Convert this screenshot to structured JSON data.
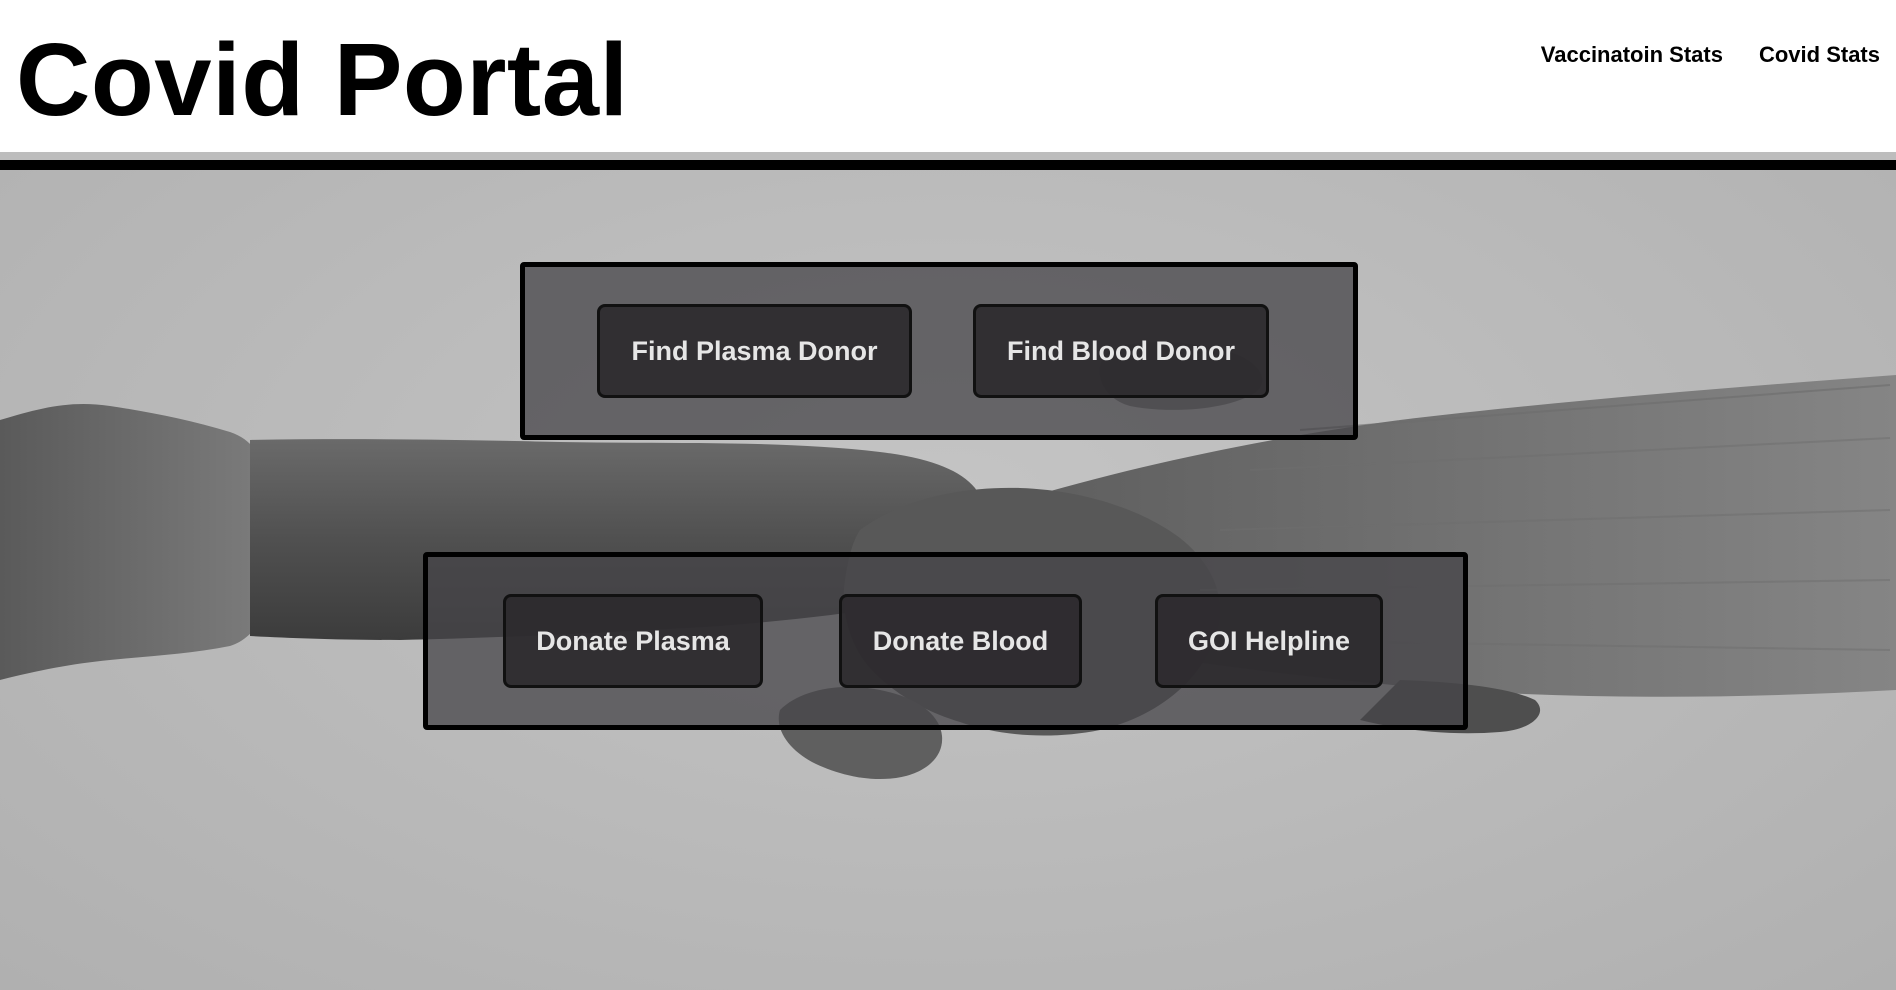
{
  "header": {
    "title": "Covid Portal",
    "nav": [
      {
        "label": "Vaccinatoin Stats"
      },
      {
        "label": "Covid Stats"
      }
    ]
  },
  "hero": {
    "find_panel": {
      "buttons": [
        {
          "label": "Find Plasma Donor"
        },
        {
          "label": "Find Blood Donor"
        }
      ]
    },
    "donate_panel": {
      "buttons": [
        {
          "label": "Donate Plasma"
        },
        {
          "label": "Donate Blood"
        },
        {
          "label": "GOI Helpline"
        }
      ]
    }
  },
  "colors": {
    "title": "#000000",
    "rule": "#000000",
    "panel_bg": "#464448",
    "button_bg": "#2d2a2e",
    "button_text": "#e6e6e6",
    "hero_bg": "#bdbdbd"
  }
}
